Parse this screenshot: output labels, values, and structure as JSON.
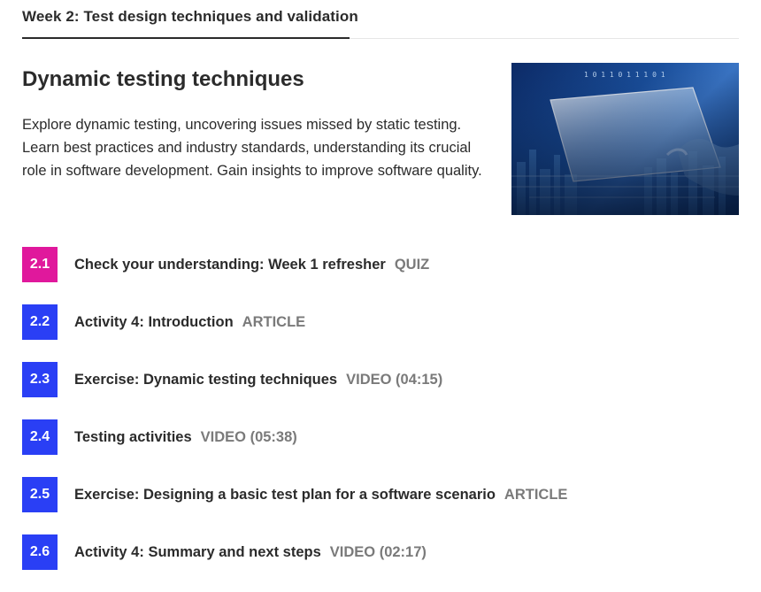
{
  "week": {
    "tab_label": "Week 2: Test design techniques and validation"
  },
  "section": {
    "title": "Dynamic testing techniques",
    "description": "Explore dynamic testing, uncovering issues missed by static testing. Learn best practices and industry standards, understanding its crucial role in software development. Gain insights to improve software quality."
  },
  "hero_image": {
    "binary_text": "1 0 1 1 0 1 1 1 0 1"
  },
  "steps": [
    {
      "number": "2.1",
      "title": "Check your understanding: Week 1 refresher",
      "type": "QUIZ",
      "color": "#e0189c"
    },
    {
      "number": "2.2",
      "title": "Activity 4: Introduction",
      "type": "ARTICLE",
      "color": "#2a3ff5"
    },
    {
      "number": "2.3",
      "title": "Exercise: Dynamic testing techniques",
      "type": "VIDEO (04:15)",
      "color": "#2a3ff5"
    },
    {
      "number": "2.4",
      "title": "Testing activities",
      "type": "VIDEO (05:38)",
      "color": "#2a3ff5"
    },
    {
      "number": "2.5",
      "title": "Exercise: Designing a basic test plan for a software scenario",
      "type": "ARTICLE",
      "color": "#2a3ff5"
    },
    {
      "number": "2.6",
      "title": "Activity 4: Summary and next steps",
      "type": "VIDEO (02:17)",
      "color": "#2a3ff5"
    }
  ]
}
